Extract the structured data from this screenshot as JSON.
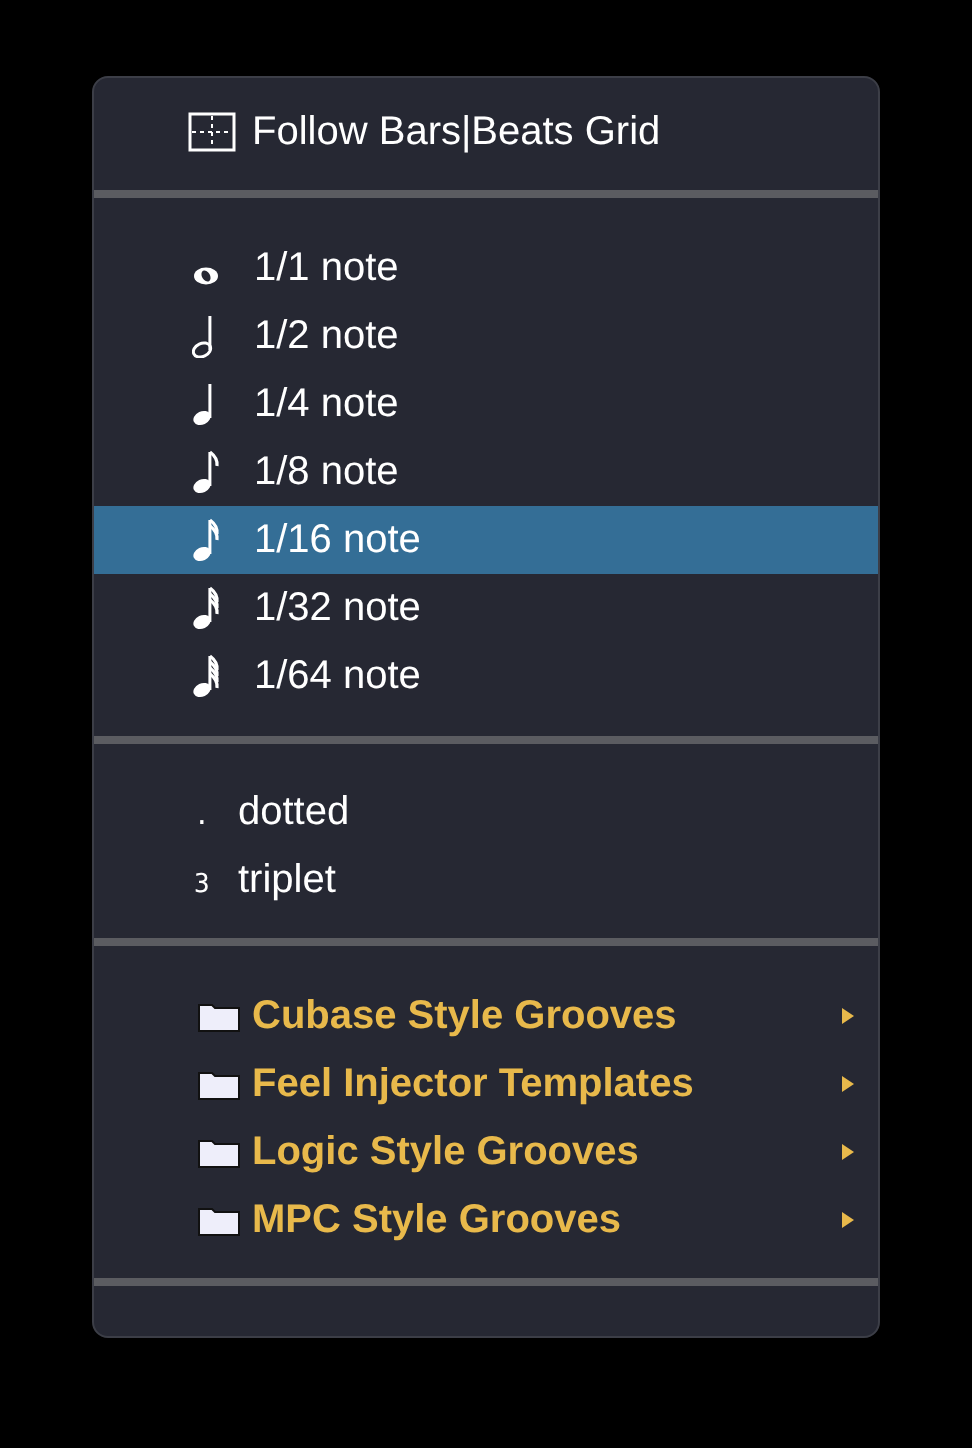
{
  "grid_option": {
    "label": "Follow Bars|Beats Grid"
  },
  "notes": [
    {
      "label": "1/1 note",
      "kind": "whole",
      "selected": false
    },
    {
      "label": "1/2 note",
      "kind": "half",
      "selected": false
    },
    {
      "label": "1/4 note",
      "kind": "quarter",
      "selected": false
    },
    {
      "label": "1/8 note",
      "kind": "eighth",
      "selected": false
    },
    {
      "label": "1/16 note",
      "kind": "sixteenth",
      "selected": true
    },
    {
      "label": "1/32 note",
      "kind": "thirtysecond",
      "selected": false
    },
    {
      "label": "1/64 note",
      "kind": "sixtyfourth",
      "selected": false
    }
  ],
  "modifiers": [
    {
      "symbol": ".",
      "label": "dotted"
    },
    {
      "symbol": "3",
      "label": "triplet"
    }
  ],
  "groove_folders": [
    {
      "label": "Cubase Style Grooves"
    },
    {
      "label": "Feel Injector Templates"
    },
    {
      "label": "Logic Style Grooves"
    },
    {
      "label": "MPC Style Grooves"
    }
  ]
}
